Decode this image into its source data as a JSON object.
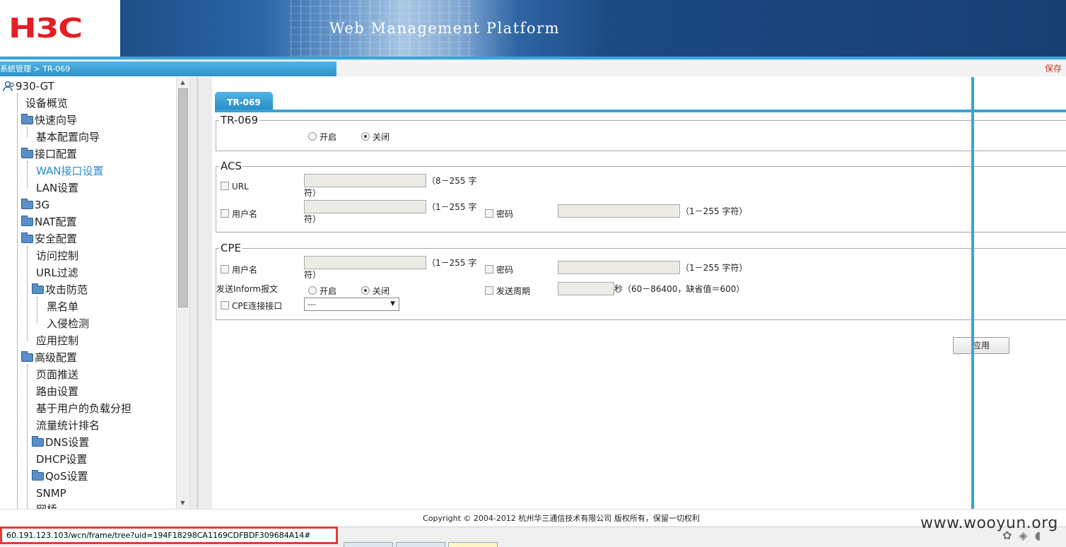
{
  "header": {
    "logo_text": "H3C",
    "platform_title": "Web Management Platform",
    "breadcrumb": "系統管理 > TR-069",
    "save_label": "保存"
  },
  "sidebar": {
    "root": "930-GT",
    "items": [
      {
        "label": "设备概览"
      },
      {
        "label": "快速向导"
      },
      {
        "label": "基本配置向导"
      },
      {
        "label": "接口配置"
      },
      {
        "label": "WAN接口设置"
      },
      {
        "label": "LAN设置"
      },
      {
        "label": "3G"
      },
      {
        "label": "NAT配置"
      },
      {
        "label": "安全配置"
      },
      {
        "label": "访问控制"
      },
      {
        "label": "URL过滤"
      },
      {
        "label": "攻击防范"
      },
      {
        "label": "黑名单"
      },
      {
        "label": "入侵检测"
      },
      {
        "label": "应用控制"
      },
      {
        "label": "高级配置"
      },
      {
        "label": "页面推送"
      },
      {
        "label": "路由设置"
      },
      {
        "label": "基于用户的负载分担"
      },
      {
        "label": "流量统计排名"
      },
      {
        "label": "DNS设置"
      },
      {
        "label": "DHCP设置"
      },
      {
        "label": "QoS设置"
      },
      {
        "label": "SNMP"
      },
      {
        "label": "网桥"
      }
    ]
  },
  "content": {
    "tab_label": "TR-069",
    "tr069": {
      "legend": "TR-069",
      "enable_label": "开启",
      "disable_label": "关闭",
      "selected": "关闭"
    },
    "acs": {
      "legend": "ACS",
      "url_label": "URL",
      "url_value": "",
      "url_hint_1": "（8－255 字",
      "url_hint_2": "符）",
      "user_label": "用户名",
      "user_value": "",
      "user_hint_1": "（1－255 字",
      "user_hint_2": "符）",
      "pwd_label": "密码",
      "pwd_value": "",
      "pwd_hint": "（1－255 字符）"
    },
    "cpe": {
      "legend": "CPE",
      "user_label": "用户名",
      "user_value": "",
      "user_hint_1": "（1－255 字",
      "user_hint_2": "符）",
      "pwd_label": "密码",
      "pwd_value": "",
      "pwd_hint": "（1－255 字符）",
      "inform_label": "发送Inform报文",
      "inform_enable": "开启",
      "inform_disable": "关闭",
      "inform_selected": "关闭",
      "period_label": "发送周期",
      "period_value": "",
      "period_hint": "秒（60－86400，缺省值＝600）",
      "iface_label": "CPE连接接口",
      "iface_value": "---"
    },
    "apply_label": "应用"
  },
  "footer": {
    "copyright": "Copyright © 2004-2012 杭州华三通信技术有限公司 版权所有，保留一切权利"
  },
  "statusbar": {
    "url": "60.191.123.103/wcn/frame/tree?uid=194F18298CA1169CDFBDF309684A14#",
    "watermark": "www.wooyun.org"
  }
}
